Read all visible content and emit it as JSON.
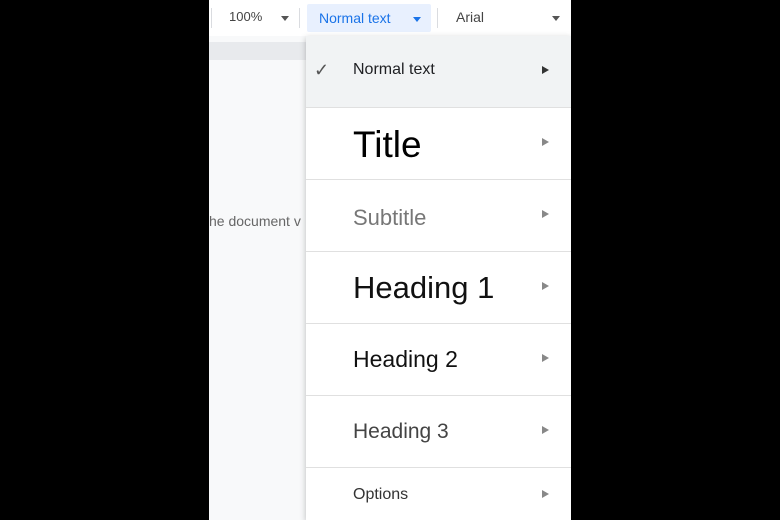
{
  "toolbar": {
    "zoom_value": "100%",
    "paragraph_style": "Normal text",
    "font": "Arial"
  },
  "document": {
    "visible_text": "he document v"
  },
  "style_menu": {
    "items": [
      {
        "label": "Normal text",
        "selected": true
      },
      {
        "label": "Title",
        "selected": false
      },
      {
        "label": "Subtitle",
        "selected": false
      },
      {
        "label": "Heading 1",
        "selected": false
      },
      {
        "label": "Heading 2",
        "selected": false
      },
      {
        "label": "Heading 3",
        "selected": false
      },
      {
        "label": "Options",
        "selected": false
      }
    ],
    "check_icon": "✓"
  }
}
